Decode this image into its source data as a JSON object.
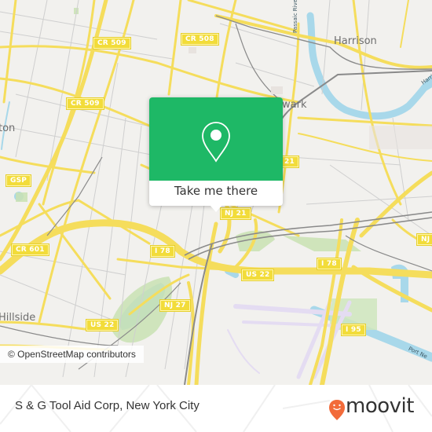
{
  "map": {
    "road_shields": [
      {
        "label": "CR 509",
        "id": "cr509-north"
      },
      {
        "label": "CR 508",
        "id": "cr508"
      },
      {
        "label": "CR 509",
        "id": "cr509-south"
      },
      {
        "label": "GSP",
        "id": "gsp"
      },
      {
        "label": "CR 601",
        "id": "cr601"
      },
      {
        "label": "I 78",
        "id": "i78-west"
      },
      {
        "label": "NJ 27",
        "id": "nj27"
      },
      {
        "label": "US 22",
        "id": "us22-west"
      },
      {
        "label": "NJ 21",
        "id": "nj21-south"
      },
      {
        "label": "21",
        "id": "nj21-north"
      },
      {
        "label": "US 22",
        "id": "us22-east"
      },
      {
        "label": "I 78",
        "id": "i78-east"
      },
      {
        "label": "I 95",
        "id": "i95"
      },
      {
        "label": "NJ",
        "id": "nj-east"
      }
    ],
    "place_labels": {
      "harrison": "Harrison",
      "newark": "wark",
      "irvington": "ton",
      "hillside": "Hillside"
    },
    "water_labels": {
      "passaic": "Passaic River",
      "harrison_reach": "Harris",
      "port_newark": "Port Ne"
    },
    "attribution": "© OpenStreetMap contributors",
    "colors": {
      "land": "#f2f1ee",
      "road_major": "#f5dd5c",
      "road_minor": "#c8c8c8",
      "water": "#a8d8ea",
      "park": "#c9e2b3",
      "rail": "#808080",
      "airport_runway": "#e4dcf2"
    }
  },
  "popup": {
    "icon": "location-pin-icon",
    "cta_label": "Take me there",
    "color": "#1eb866"
  },
  "footer": {
    "title": "S & G Tool Aid Corp, New York City",
    "brand": "moovit",
    "brand_color": "#f26b3a"
  }
}
